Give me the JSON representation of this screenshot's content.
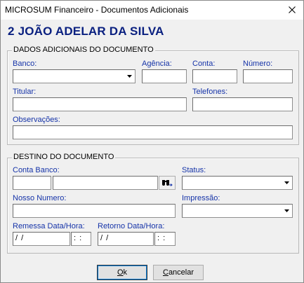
{
  "window": {
    "title": "MICROSUM Financeiro - Documentos Adicionais",
    "close_symbol": "✕"
  },
  "header": {
    "client_name": "2 JOÃO ADELAR DA SILVA"
  },
  "dados": {
    "group_title": "DADOS ADICIONAIS DO DOCUMENTO",
    "banco_label": "Banco:",
    "banco_value": "",
    "agencia_label": "Agência:",
    "agencia_value": "",
    "conta_label": "Conta:",
    "conta_value": "",
    "numero_label": "Número:",
    "numero_value": "",
    "titular_label": "Titular:",
    "titular_value": "",
    "telefones_label": "Telefones:",
    "telefones_value": "",
    "observacoes_label": "Observações:",
    "observacoes_value": ""
  },
  "destino": {
    "group_title": "DESTINO DO DOCUMENTO",
    "conta_banco_label": "Conta Banco:",
    "conta_banco_code": "",
    "conta_banco_name": "",
    "status_label": "Status:",
    "status_value": "",
    "nosso_numero_label": "Nosso Numero:",
    "nosso_numero_value": "",
    "impressao_label": "Impressão:",
    "impressao_value": "",
    "remessa_label": "Remessa Data/Hora:",
    "remessa_date": " / /",
    "remessa_time": " : :",
    "retorno_label": "Retorno Data/Hora:",
    "retorno_date": " / /",
    "retorno_time": " : :"
  },
  "buttons": {
    "ok_mnemonic": "O",
    "ok_rest": "k",
    "cancel_mnemonic": "C",
    "cancel_rest": "ancelar"
  },
  "icons": {
    "close": "close-icon",
    "dropdown": "chevron-down-icon",
    "find": "binoculars-icon"
  }
}
